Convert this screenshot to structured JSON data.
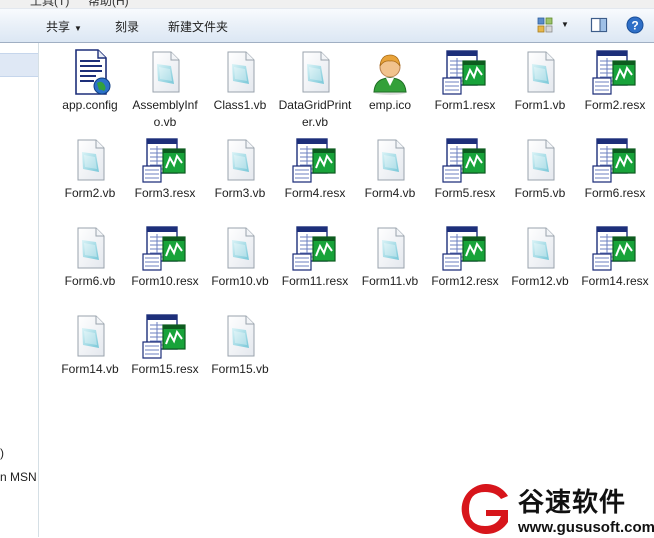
{
  "menubar": {
    "items": [
      "工具(T)",
      "帮助(H)"
    ]
  },
  "toolbar": {
    "share_label": "共享",
    "burn_label": "刻录",
    "new_folder_label": "新建文件夹"
  },
  "nav": {
    "fragment1": ")",
    "fragment2": "n MSN"
  },
  "files": [
    {
      "name": "app.config",
      "icon": "config-file-icon"
    },
    {
      "name": "AssemblyInfo.vb",
      "icon": "vb-file-icon"
    },
    {
      "name": "Class1.vb",
      "icon": "vb-file-icon"
    },
    {
      "name": "DataGridPrinter.vb",
      "icon": "vb-file-icon"
    },
    {
      "name": "emp.ico",
      "icon": "person-icon"
    },
    {
      "name": "Form1.resx",
      "icon": "resx-file-icon"
    },
    {
      "name": "Form1.vb",
      "icon": "vb-file-icon"
    },
    {
      "name": "Form2.resx",
      "icon": "resx-file-icon"
    },
    {
      "name": "Form2.vb",
      "icon": "vb-file-icon"
    },
    {
      "name": "Form3.resx",
      "icon": "resx-file-icon"
    },
    {
      "name": "Form3.vb",
      "icon": "vb-file-icon"
    },
    {
      "name": "Form4.resx",
      "icon": "resx-file-icon"
    },
    {
      "name": "Form4.vb",
      "icon": "vb-file-icon"
    },
    {
      "name": "Form5.resx",
      "icon": "resx-file-icon"
    },
    {
      "name": "Form5.vb",
      "icon": "vb-file-icon"
    },
    {
      "name": "Form6.resx",
      "icon": "resx-file-icon"
    },
    {
      "name": "Form6.vb",
      "icon": "vb-file-icon"
    },
    {
      "name": "Form10.resx",
      "icon": "resx-file-icon"
    },
    {
      "name": "Form10.vb",
      "icon": "vb-file-icon"
    },
    {
      "name": "Form11.resx",
      "icon": "resx-file-icon"
    },
    {
      "name": "Form11.vb",
      "icon": "vb-file-icon"
    },
    {
      "name": "Form12.resx",
      "icon": "resx-file-icon"
    },
    {
      "name": "Form12.vb",
      "icon": "vb-file-icon"
    },
    {
      "name": "Form14.resx",
      "icon": "resx-file-icon"
    },
    {
      "name": "Form14.vb",
      "icon": "vb-file-icon"
    },
    {
      "name": "Form15.resx",
      "icon": "resx-file-icon"
    },
    {
      "name": "Form15.vb",
      "icon": "vb-file-icon"
    }
  ],
  "watermark": {
    "brand": "谷速软件",
    "url": "www.gususoft.com"
  },
  "colors": {
    "toolbar_top": "#f8fbfe",
    "toolbar_bottom": "#dce7f4",
    "resx_green": "#1e9e2e",
    "watermark_red": "#d7151b"
  }
}
